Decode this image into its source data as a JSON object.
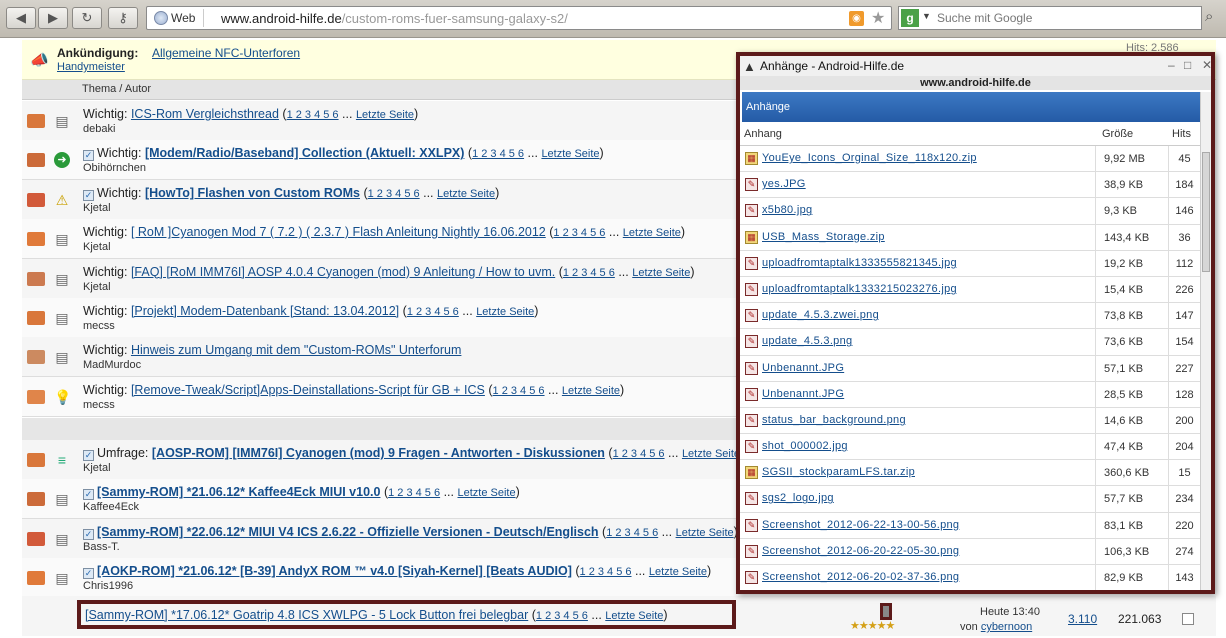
{
  "browser": {
    "tab_label": "Web",
    "url_domain": "www.android-hilfe.de",
    "url_path": "/custom-roms-fuer-samsung-galaxy-s2/",
    "search_placeholder": "Suche mit Google"
  },
  "announcement": {
    "label": "Ankündigung:",
    "link": "Allgemeine NFC-Unterforen",
    "user": "Handymeister",
    "hits_peek": "Hits: 2.586"
  },
  "thread_header": "Thema / Autor",
  "threads": [
    {
      "prefix": "Wichtig:",
      "title": "ICS-Rom Vergleichsthread",
      "bold": false,
      "check": false,
      "pages": "1 2 3 4 5 6",
      "last": "Letzte Seite",
      "author": "debaki",
      "icon": "doc"
    },
    {
      "prefix": "Wichtig:",
      "title": "[Modem/Radio/Baseband] Collection (Aktuell: XXLPX)",
      "bold": true,
      "check": true,
      "pages": "1 2 3 4 5 6",
      "last": "Letzte Seite",
      "author": "Obihörnchen",
      "icon": "arrow"
    },
    {
      "prefix": "Wichtig:",
      "title": "[HowTo] Flashen von Custom ROMs",
      "bold": true,
      "check": true,
      "pages": "1 2 3 4 5 6",
      "last": "Letzte Seite",
      "author": "Kjetal",
      "icon": "warn"
    },
    {
      "prefix": "Wichtig:",
      "title": "[ RoM ]Cyanogen Mod 7 ( 7.2 ) ( 2.3.7 ) Flash Anleitung Nightly 16.06.2012",
      "bold": false,
      "check": false,
      "pages": "1 2 3 4 5 6",
      "last": "Letzte Seite",
      "author": "Kjetal",
      "icon": "doc"
    },
    {
      "prefix": "Wichtig:",
      "title": "[FAQ] [RoM IMM76I] AOSP 4.0.4 Cyanogen (mod) 9 Anleitung / How to uvm.",
      "bold": false,
      "check": false,
      "pages": "1 2 3 4 5 6",
      "last": "Letzte Seite",
      "author": "Kjetal",
      "icon": "doc"
    },
    {
      "prefix": "Wichtig:",
      "title": "[Projekt] Modem-Datenbank [Stand: 13.04.2012]",
      "bold": false,
      "check": false,
      "pages": "1 2 3 4 5 6",
      "last": "Letzte Seite",
      "author": "mecss",
      "icon": "doc"
    },
    {
      "prefix": "Wichtig:",
      "title": "Hinweis zum Umgang mit dem \"Custom-ROMs\" Unterforum",
      "bold": false,
      "check": false,
      "pages": "",
      "last": "",
      "author": "MadMurdoc",
      "icon": "doc"
    },
    {
      "prefix": "Wichtig:",
      "title": "[Remove-Tweak/Script]Apps-Deinstallations-Script für GB + ICS",
      "bold": false,
      "check": false,
      "pages": "1 2 3 4 5 6",
      "last": "Letzte Seite",
      "author": "mecss",
      "icon": "bulb"
    }
  ],
  "threads2": [
    {
      "prefix": "Umfrage:",
      "title": "[AOSP-ROM] [IMM76I] Cyanogen (mod) 9 Fragen - Antworten - Diskussionen",
      "bold": true,
      "check": true,
      "pages": "1 2 3 4 5 6",
      "last": "Letzte Seite",
      "author": "Kjetal",
      "icon": "poll"
    },
    {
      "prefix": "",
      "title": "[Sammy-ROM] *21.06.12* Kaffee4Eck MIUI v10.0",
      "bold": true,
      "check": true,
      "pages": "1 2 3 4 5 6",
      "last": "Letzte Seite",
      "author": "Kaffee4Eck",
      "icon": "doc"
    },
    {
      "prefix": "",
      "title": "[Sammy-ROM] *22.06.12* MIUI V4 ICS 2.6.22 - Offizielle Versionen - Deutsch/Englisch",
      "bold": true,
      "check": true,
      "pages": "1 2 3 4 5 6",
      "last": "Letzte Seite",
      "author": "Bass-T.",
      "icon": "doc"
    },
    {
      "prefix": "",
      "title": "[AOKP-ROM] *21.06.12* [B-39] AndyX ROM ™ v4.0 [Siyah-Kernel] [Beats AUDIO]",
      "bold": true,
      "check": true,
      "pages": "1 2 3 4 5 6",
      "last": "Letzte Seite",
      "author": "Chris1996",
      "icon": "doc"
    }
  ],
  "last_thread": {
    "title": "[Sammy-ROM] *17.06.12* Goatrip 4.8 ICS XWLPG - 5 Lock Button frei belegbar",
    "pages": "1 2 3 4 5 6",
    "last": "Letzte Seite",
    "time": "Heute 13:40",
    "by_label": "von",
    "by_user": "cybernoon",
    "replies": "3.110",
    "views": "221.063"
  },
  "popup": {
    "title": "Anhänge - Android-Hilfe.de",
    "url": "www.android-hilfe.de",
    "category": "Anhänge",
    "col_name": "Anhang",
    "col_size": "Größe",
    "col_hits": "Hits",
    "files": [
      {
        "name": "YouEye_Icons_Orginal_Size_118x120.zip",
        "size": "9,92 MB",
        "hits": "45",
        "type": "zip"
      },
      {
        "name": "yes.JPG",
        "size": "38,9 KB",
        "hits": "184",
        "type": "img"
      },
      {
        "name": "x5b80.jpg",
        "size": "9,3 KB",
        "hits": "146",
        "type": "img"
      },
      {
        "name": "USB_Mass_Storage.zip",
        "size": "143,4 KB",
        "hits": "36",
        "type": "zip"
      },
      {
        "name": "uploadfromtaptalk1333555821345.jpg",
        "size": "19,2 KB",
        "hits": "112",
        "type": "img"
      },
      {
        "name": "uploadfromtaptalk1333215023276.jpg",
        "size": "15,4 KB",
        "hits": "226",
        "type": "img"
      },
      {
        "name": "update_4.5.3.zwei.png",
        "size": "73,8 KB",
        "hits": "147",
        "type": "img"
      },
      {
        "name": "update_4.5.3.png",
        "size": "73,6 KB",
        "hits": "154",
        "type": "img"
      },
      {
        "name": "Unbenannt.JPG",
        "size": "57,1 KB",
        "hits": "227",
        "type": "img"
      },
      {
        "name": "Unbenannt.JPG",
        "size": "28,5 KB",
        "hits": "128",
        "type": "img"
      },
      {
        "name": "status_bar_background.png",
        "size": "14,6 KB",
        "hits": "200",
        "type": "img"
      },
      {
        "name": "shot_000002.jpg",
        "size": "47,4 KB",
        "hits": "204",
        "type": "img"
      },
      {
        "name": "SGSII_stockparamLFS.tar.zip",
        "size": "360,6 KB",
        "hits": "15",
        "type": "zip"
      },
      {
        "name": "sgs2_logo.jpg",
        "size": "57,7 KB",
        "hits": "234",
        "type": "img"
      },
      {
        "name": "Screenshot_2012-06-22-13-00-56.png",
        "size": "83,1 KB",
        "hits": "220",
        "type": "img"
      },
      {
        "name": "Screenshot_2012-06-20-22-05-30.png",
        "size": "106,3 KB",
        "hits": "274",
        "type": "img"
      },
      {
        "name": "Screenshot_2012-06-20-02-37-36.png",
        "size": "82,9 KB",
        "hits": "143",
        "type": "img"
      }
    ]
  }
}
